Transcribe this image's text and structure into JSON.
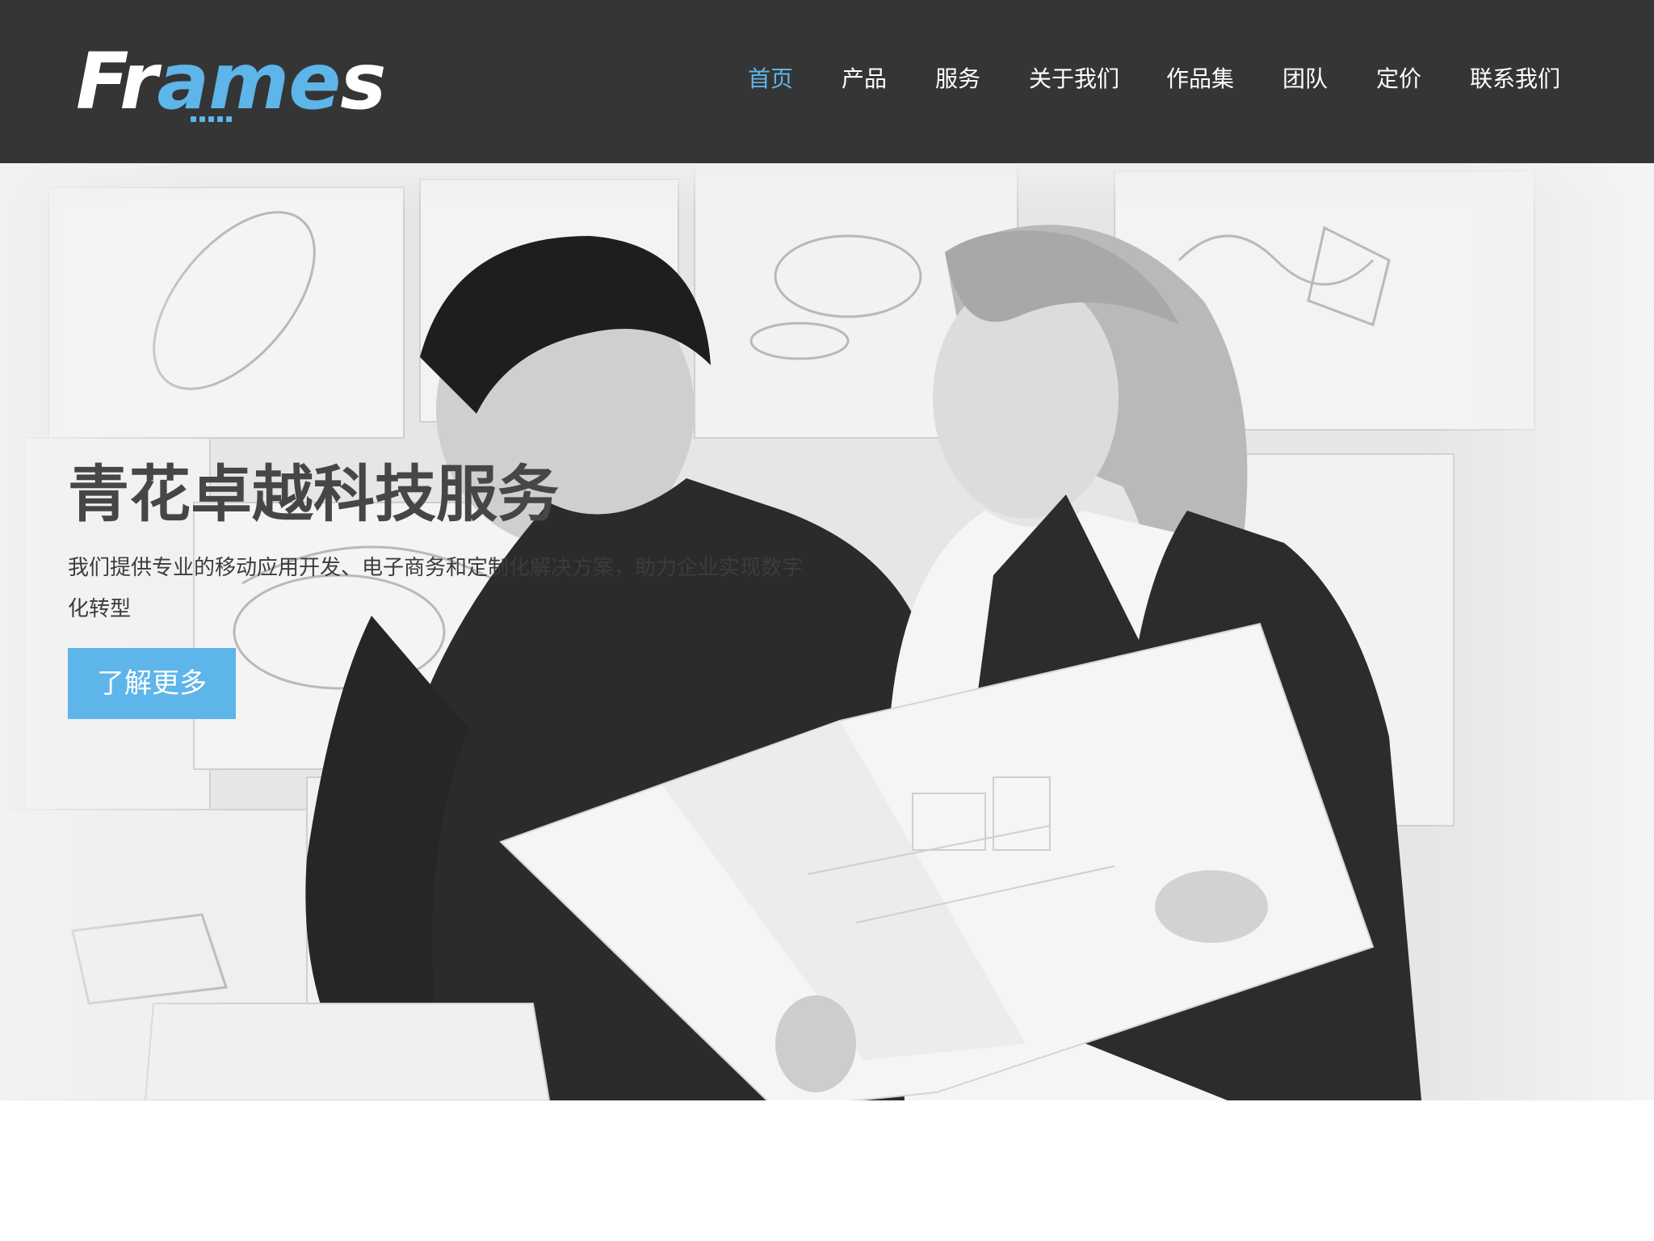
{
  "header": {
    "logo": {
      "part_before": "Fr",
      "part_accent": "ame",
      "part_after": "s"
    },
    "nav": [
      {
        "label": "首页",
        "active": true
      },
      {
        "label": "产品",
        "active": false
      },
      {
        "label": "服务",
        "active": false
      },
      {
        "label": "关于我们",
        "active": false
      },
      {
        "label": "作品集",
        "active": false
      },
      {
        "label": "团队",
        "active": false
      },
      {
        "label": "定价",
        "active": false
      },
      {
        "label": "联系我们",
        "active": false
      }
    ]
  },
  "hero": {
    "title": "青花卓越科技服务",
    "description": "我们提供专业的移动应用开发、电子商务和定制化解决方案，助力企业实现数字化转型",
    "cta_label": "了解更多"
  },
  "colors": {
    "header_bg": "#353535",
    "accent": "#5db5ea",
    "nav_text": "#ffffff",
    "hero_title": "#464646",
    "hero_text": "#3c3c3c"
  }
}
